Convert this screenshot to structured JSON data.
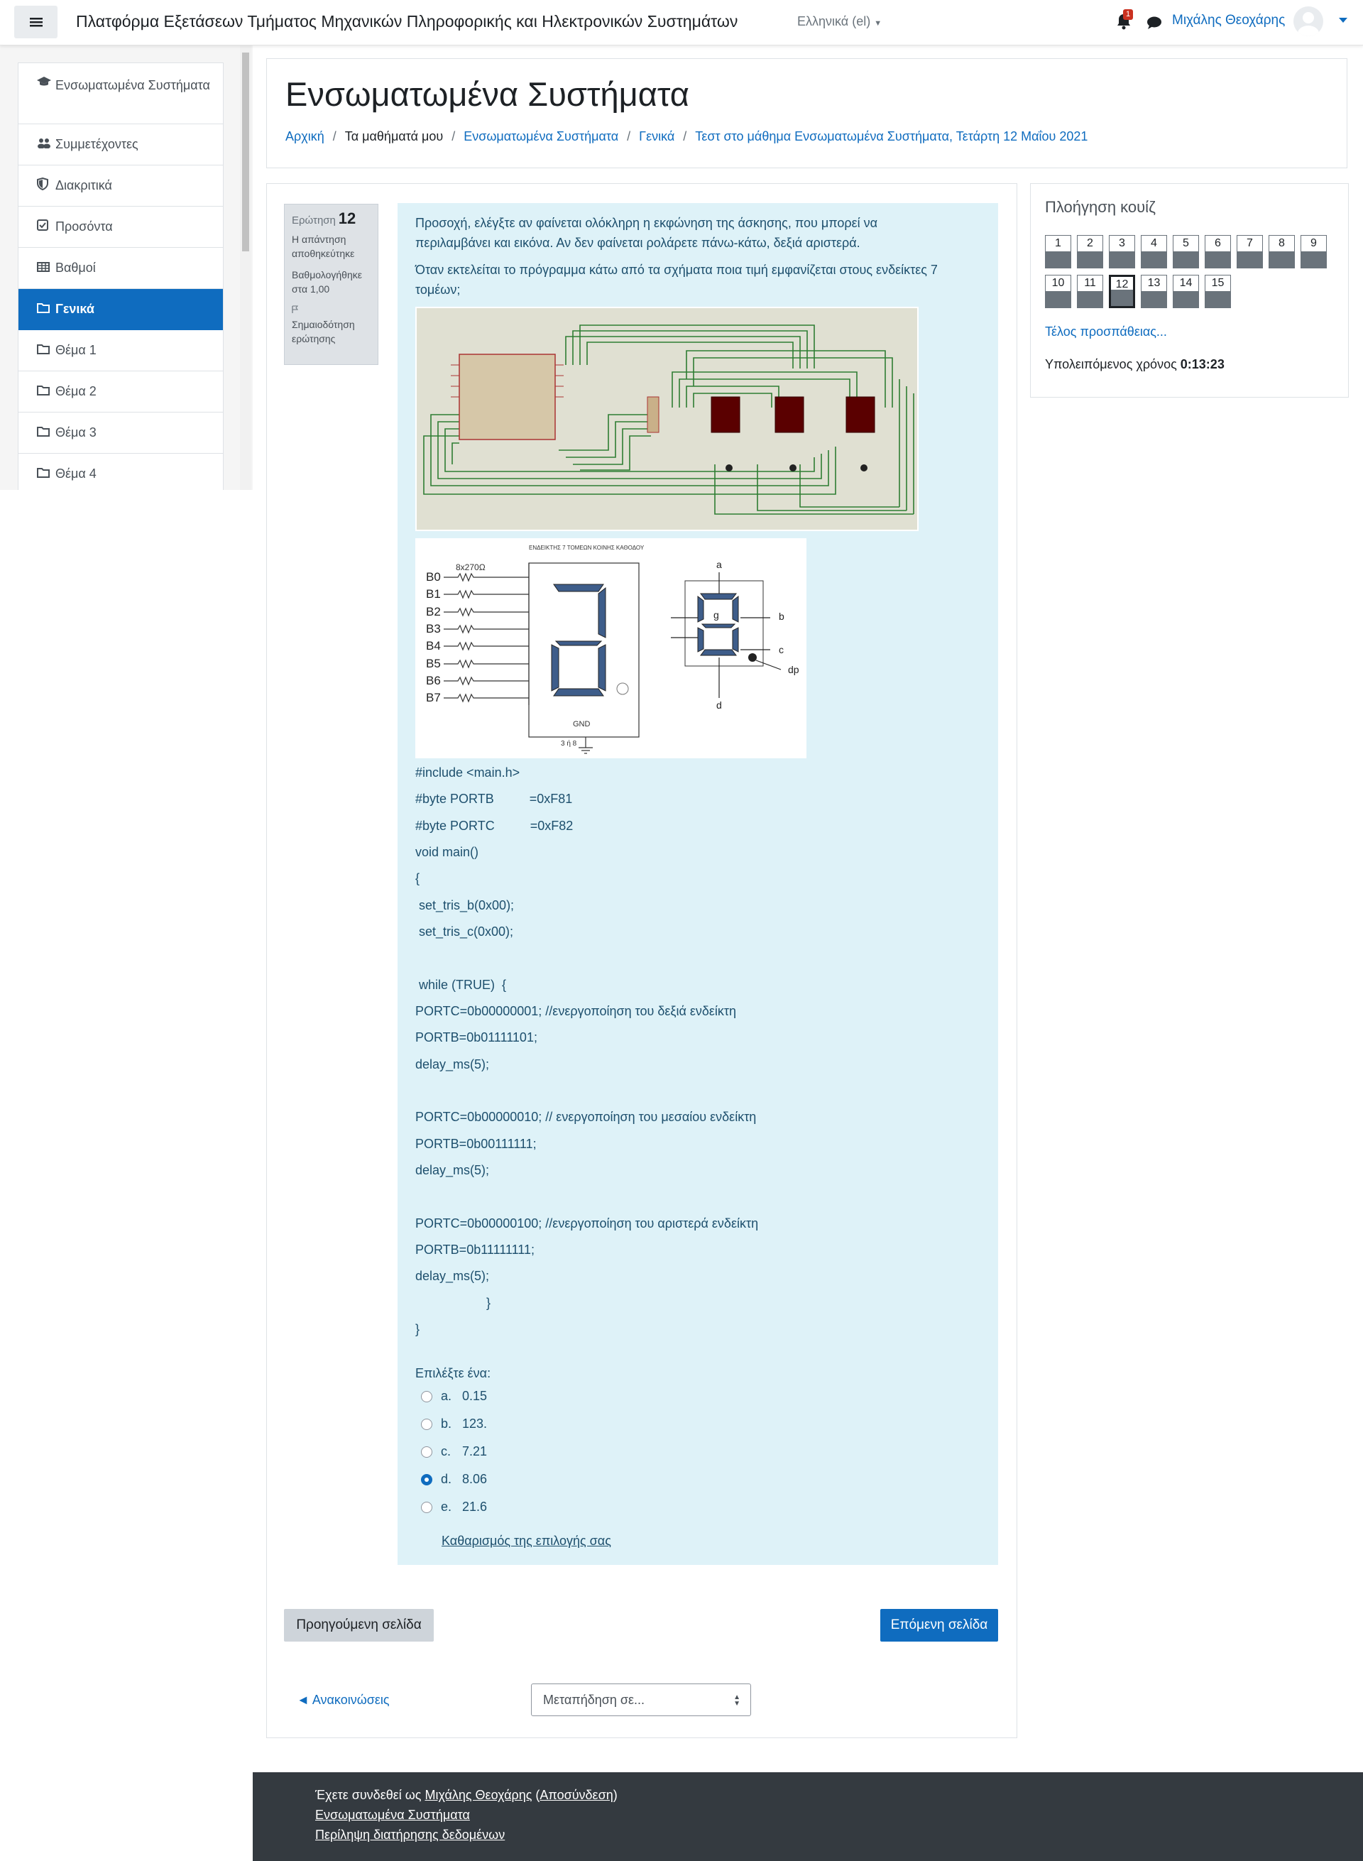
{
  "navbar": {
    "site_title": "Πλατφόρμα Εξετάσεων Τμήματος Μηχανικών Πληροφορικής και Ηλεκτρονικών Συστημάτων",
    "language": "Ελληνικά (el)",
    "notification_count": "1",
    "user_name": "Μιχάλης Θεοχάρης"
  },
  "drawer": {
    "items": [
      {
        "label": "Ενσωματωμένα Συστήματα",
        "icon": "graduation-cap-icon"
      },
      {
        "label": "Συμμετέχοντες",
        "icon": "users-icon"
      },
      {
        "label": "Διακριτικά",
        "icon": "shield-icon"
      },
      {
        "label": "Προσόντα",
        "icon": "check-square-icon"
      },
      {
        "label": "Βαθμοί",
        "icon": "table-icon"
      },
      {
        "label": "Γενικά",
        "icon": "folder-icon",
        "active": true
      },
      {
        "label": "Θέμα 1",
        "icon": "folder-icon"
      },
      {
        "label": "Θέμα 2",
        "icon": "folder-icon"
      },
      {
        "label": "Θέμα 3",
        "icon": "folder-icon"
      },
      {
        "label": "Θέμα 4",
        "icon": "folder-icon"
      }
    ]
  },
  "header": {
    "title": "Ενσωματωμένα Συστήματα",
    "breadcrumb": [
      "Αρχική",
      "Τα μαθήματά μου",
      "Ενσωματωμένα Συστήματα",
      "Γενικά",
      "Τεστ στο μάθημα Ενσωματωμένα Συστήματα, Τετάρτη 12 Μαΐου 2021"
    ]
  },
  "question_info": {
    "label": "Ερώτηση",
    "number": "12",
    "state": "Η απάντηση αποθηκεύτηκε",
    "grade": "Βαθμολογήθηκε στα 1,00",
    "flag": "Σημαιοδότηση ερώτησης"
  },
  "question": {
    "warning": "Προσοχή, ελέγξτε αν φαίνεται ολόκληρη η εκφώνηση της άσκησης, που μπορεί να περιλαμβάνει και εικόνα. Αν δεν φαίνεται ρολάρετε πάνω-κάτω, δεξιά αριστερά.",
    "text": "Όταν εκτελείται το πρόγραμμα κάτω από τα σχήματα ποια τιμή εμφανίζεται στους ενδείκτες 7 τομέων;",
    "code": [
      "#include <main.h>",
      "#byte PORTB          =0xF81",
      "#byte PORTC          =0xF82",
      "void main()",
      "{",
      " set_tris_b(0x00);",
      " set_tris_c(0x00);",
      "",
      " while (TRUE)  {",
      "PORTC=0b00000001; //ενεργοποίηση του δεξιά ενδείκτη",
      "PORTB=0b01111101;",
      "delay_ms(5);",
      "",
      "PORTC=0b00000010; // ενεργοποίηση του μεσαίου ενδείκτη",
      "PORTB=0b00111111;",
      "delay_ms(5);",
      "",
      "PORTC=0b00000100; //ενεργοποίηση του αριστερά ενδείκτη",
      "PORTB=0b11111111;",
      "delay_ms(5);",
      "                    }",
      "}"
    ],
    "diagram_title": "ΕΝΔΕΙΚΤΗΣ 7 ΤΟΜΕΩΝ ΚΟΙΝΗΣ ΚΑΘΟΔΟΥ",
    "diagram_resistor": "8x270Ω",
    "diagram_gnd": "GND",
    "diagram_pins": "3 ή 8",
    "prompt": "Επιλέξτε ένα:",
    "options": [
      {
        "letter": "a.",
        "value": "0.15",
        "checked": false
      },
      {
        "letter": "b.",
        "value": "123.",
        "checked": false
      },
      {
        "letter": "c.",
        "value": "7.21",
        "checked": false
      },
      {
        "letter": "d.",
        "value": "8.06",
        "checked": true
      },
      {
        "letter": "e.",
        "value": "21.6",
        "checked": false
      }
    ],
    "clear_choice": "Καθαρισμός της επιλογής σας"
  },
  "navigation": {
    "prev_page": "Προηγούμενη σελίδα",
    "next_page": "Επόμενη σελίδα",
    "prev_activity": "◄ Ανακοινώσεις",
    "jump_placeholder": "Μεταπήδηση σε..."
  },
  "quiz_nav": {
    "title": "Πλοήγηση κουίζ",
    "questions": [
      "1",
      "2",
      "3",
      "4",
      "5",
      "6",
      "7",
      "8",
      "9",
      "10",
      "11",
      "12",
      "13",
      "14",
      "15"
    ],
    "current": "12",
    "finish": "Τέλος προσπάθειας...",
    "time_label": "Υπολειπόμενος χρόνος",
    "time_value": "0:13:23"
  },
  "footer": {
    "logged_in_as": "Έχετε συνδεθεί ως",
    "user": "Μιχάλης Θεοχάρης",
    "logout": "Αποσύνδεση",
    "course": "Ενσωματωμένα Συστήματα",
    "data_retention": "Περίληψη διατήρησης δεδομένων"
  }
}
